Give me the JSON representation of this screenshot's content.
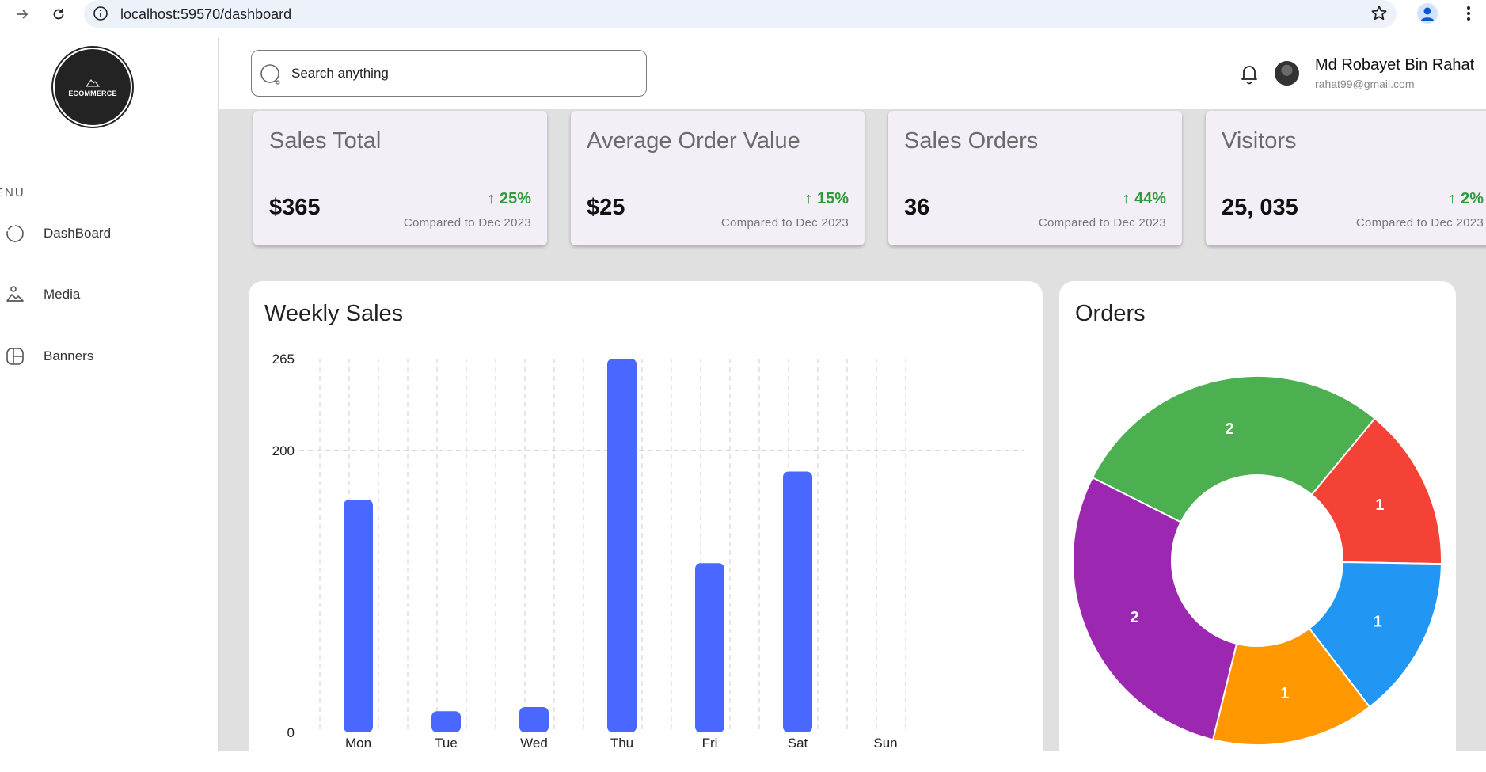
{
  "browser": {
    "url": "localhost:59570/dashboard"
  },
  "sidebar": {
    "logo_text": "ECOMMERCE",
    "menu_label": "ENU",
    "items": [
      {
        "label": "DashBoard",
        "icon": "dashboard-icon"
      },
      {
        "label": "Media",
        "icon": "media-icon"
      },
      {
        "label": "Banners",
        "icon": "banners-icon"
      }
    ]
  },
  "header": {
    "search_placeholder": "Search anything",
    "user_name": "Md Robayet Bin Rahat",
    "user_email": "rahat99@gmail.com"
  },
  "stats": [
    {
      "title": "Sales Total",
      "value": "$365",
      "change": "25%",
      "compare": "Compared to Dec 2023"
    },
    {
      "title": "Average Order Value",
      "value": "$25",
      "change": "15%",
      "compare": "Compared to Dec 2023"
    },
    {
      "title": "Sales Orders",
      "value": "36",
      "change": "44%",
      "compare": "Compared to Dec 2023"
    },
    {
      "title": "Visitors",
      "value": "25, 035",
      "change": "2%",
      "compare": "Compared to Dec 2023"
    }
  ],
  "colors": {
    "bar": "#4a67ff",
    "up": "#2e9c3c",
    "card_bg": "#f4eff7"
  },
  "weekly_sales": {
    "title": "Weekly Sales",
    "chart_data": {
      "type": "bar",
      "categories": [
        "Mon",
        "Tue",
        "Wed",
        "Thu",
        "Fri",
        "Sat",
        "Sun"
      ],
      "values": [
        165,
        15,
        18,
        265,
        120,
        185,
        0
      ],
      "ylim": [
        0,
        265
      ],
      "yticks": [
        "0",
        "200",
        "265"
      ],
      "grid": true
    }
  },
  "orders": {
    "title": "Orders",
    "chart_data": {
      "type": "pie",
      "donut": true,
      "slices": [
        {
          "value": 1,
          "label": "1",
          "color": "#f44336"
        },
        {
          "value": 1,
          "label": "1",
          "color": "#2196f3"
        },
        {
          "value": 1,
          "label": "1",
          "color": "#ff9800"
        },
        {
          "value": 2,
          "label": "2",
          "color": "#9c27b0"
        },
        {
          "value": 2,
          "label": "2",
          "color": "#4caf50"
        }
      ]
    }
  }
}
